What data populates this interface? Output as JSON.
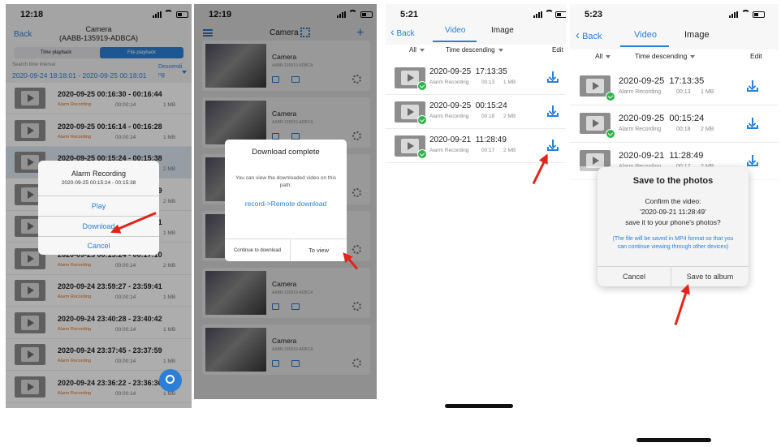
{
  "s1": {
    "time": "12:18",
    "back": "Back",
    "title": "Camera",
    "subtitle": "(AABB-135919-ADBCA)",
    "seg_time": "Time playback",
    "seg_file": "File playback",
    "interval_label": "Search time interval",
    "interval": "2020-09-24 18:18:01 - 2020-09-25 00:18:01",
    "sort": "Descending",
    "rows": [
      {
        "range": "2020-09-25 00:16:30 - 00:16:44",
        "type": "Alarm Recording",
        "dur": "00:00:14",
        "size": "1 MB"
      },
      {
        "range": "2020-09-25 00:16:14 - 00:16:28",
        "type": "Alarm Recording",
        "dur": "00:00:14",
        "size": "1 MB"
      },
      {
        "range": "2020-09-25 00:15:24 - 00:15:38",
        "type": "Alarm Recording",
        "dur": "00:00:14",
        "size": "2 MB"
      },
      {
        "range": "2020-09-25 00:15:24 - 00:15:49",
        "type": "Alarm Recording",
        "dur": "00:00:14",
        "size": "2 MB"
      },
      {
        "range": "2020-09-25 00:15:24 - 00:15:01",
        "type": "Alarm Recording",
        "dur": "00:00:14",
        "size": "1 MB"
      },
      {
        "range": "2020-09-25 00:15:24 - 00:17:10",
        "type": "Alarm Recording",
        "dur": "00:00:14",
        "size": "2 MB"
      },
      {
        "range": "2020-09-24 23:59:27 - 23:59:41",
        "type": "Alarm Recording",
        "dur": "00:00:14",
        "size": "1 MB"
      },
      {
        "range": "2020-09-24 23:40:28 - 23:40:42",
        "type": "Alarm Recording",
        "dur": "00:00:14",
        "size": "1 MB"
      },
      {
        "range": "2020-09-24 23:37:45 - 23:37:59",
        "type": "Alarm Recording",
        "dur": "00:00:14",
        "size": "1 MB"
      },
      {
        "range": "2020-09-24 23:36:22 - 23:36:36",
        "type": "Alarm Recording",
        "dur": "00:00:14",
        "size": "1 MB"
      }
    ],
    "popup_title": "Alarm Recording",
    "popup_range": "2020-09-25 00:15:24 - 00:15:38",
    "play": "Play",
    "download": "Download",
    "cancel": "Cancel"
  },
  "s2": {
    "time": "12:19",
    "title": "Camera",
    "cams": [
      {
        "name": "Camera",
        "id": "AABB-135919-ADBCA"
      },
      {
        "name": "Camera",
        "id": "AABB-135919-ADBCA"
      },
      {
        "name": "Camera",
        "id": "AABB-135919-ADBCA"
      },
      {
        "name": "Camera",
        "id": "AABB-135919-ADBCA"
      },
      {
        "name": "Camera",
        "id": "AABB-135919-ADBCA"
      },
      {
        "name": "Camera",
        "id": "AABB-135919-ADBCA"
      }
    ],
    "dialog_title": "Download complete",
    "dialog_msg": "You can view the downloaded video on this path:",
    "dialog_path": "record->Remote download",
    "continue": "Continue to download",
    "view": "To view"
  },
  "s3": {
    "time": "5:21",
    "back": "Back",
    "tab_video": "Video",
    "tab_image": "Image",
    "filter_all": "All",
    "filter_sort": "Time descending",
    "edit": "Edit",
    "rows": [
      {
        "dt": "2020-09-25  17:13:35",
        "type": "Alarm Recording",
        "dur": "00:13",
        "size": "1 MB"
      },
      {
        "dt": "2020-09-25  00:15:24",
        "type": "Alarm Recording",
        "dur": "00:18",
        "size": "2 MB"
      },
      {
        "dt": "2020-09-21  11:28:49",
        "type": "Alarm Recording",
        "dur": "00:17",
        "size": "2 MB"
      }
    ]
  },
  "s4": {
    "time": "5:23",
    "back": "Back",
    "tab_video": "Video",
    "tab_image": "Image",
    "filter_all": "All",
    "filter_sort": "Time descending",
    "edit": "Edit",
    "rows": [
      {
        "dt": "2020-09-25  17:13:35",
        "type": "Alarm Recording",
        "dur": "00:13",
        "size": "1 MB"
      },
      {
        "dt": "2020-09-25  00:15:24",
        "type": "Alarm Recording",
        "dur": "00:18",
        "size": "2 MB"
      },
      {
        "dt": "2020-09-21  11:28:49",
        "type": "Alarm Recording",
        "dur": "00:17",
        "size": "2 MB"
      }
    ],
    "dialog_title": "Save to the photos",
    "confirm1": "Confirm the video:",
    "confirm2": "'2020-09-21  11:28:49'",
    "confirm3": "save it to your phone's photos?",
    "note": "(The file will be saved in MP4 format so that you can continue viewing through other devices)",
    "cancel": "Cancel",
    "save": "Save to album"
  }
}
